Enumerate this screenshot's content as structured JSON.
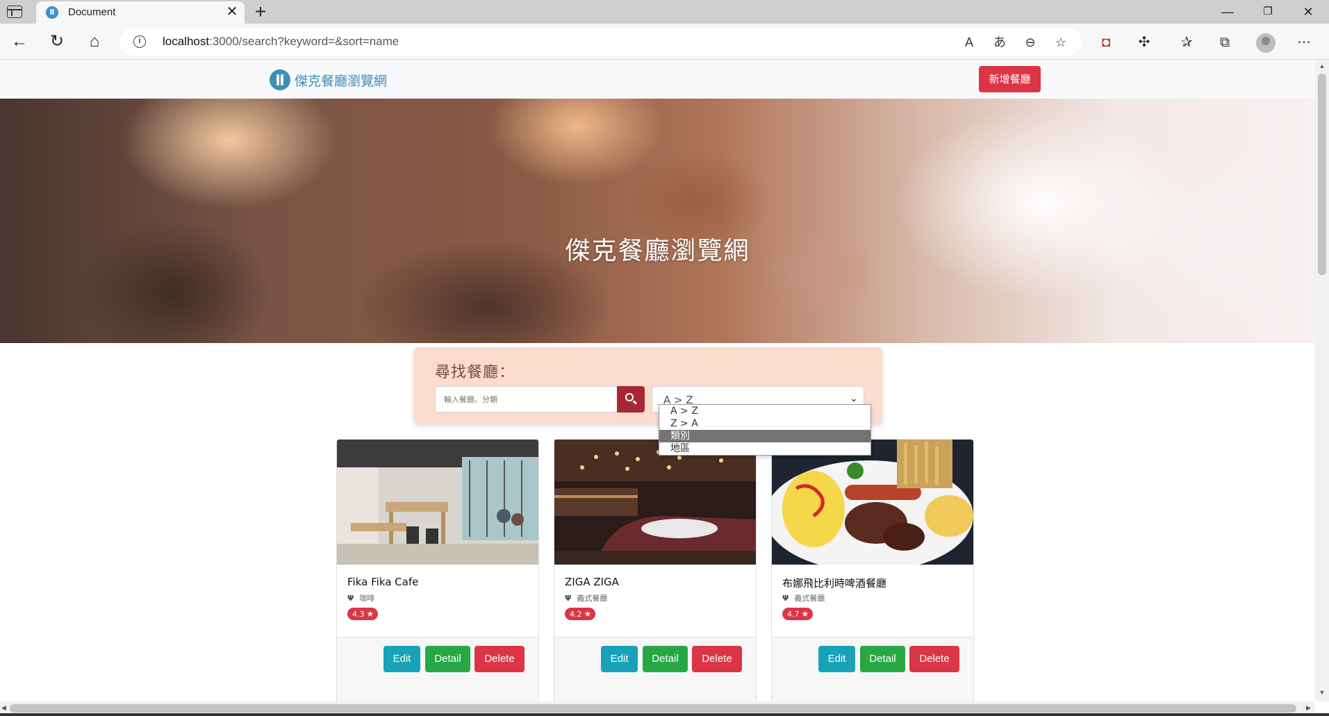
{
  "browser": {
    "tab_title": "Document",
    "tab_favicon": "Ⅱ",
    "close_glyph": "✕",
    "new_tab_glyph": "+",
    "url_host": "localhost",
    "url_rest": ":3000/search?keyword=&sort=name",
    "window_controls": [
      "—",
      "❐",
      "✕"
    ]
  },
  "nav": {
    "brand": "傑克餐廳瀏覽網",
    "add_button": "新增餐廳"
  },
  "banner": {
    "title": "傑克餐廳瀏覽網"
  },
  "search": {
    "label": "尋找餐廳：",
    "placeholder": "輸入餐廳、分類",
    "sort_value": "A > Z",
    "sort_options": [
      "A > Z",
      "Z > A",
      "類別",
      "地區"
    ],
    "highlighted_option": "類別"
  },
  "restaurants": [
    {
      "name": "Fika Fika Cafe",
      "category": "咖啡",
      "rating": "4.3"
    },
    {
      "name": "ZIGA ZIGA",
      "category": "義式餐廳",
      "rating": "4.2"
    },
    {
      "name": "布娜飛比利時啤酒餐廳",
      "category": "義式餐廳",
      "rating": "4.7"
    }
  ],
  "card_buttons": {
    "edit": "Edit",
    "detail": "Detail",
    "delete": "Delete"
  },
  "colors": {
    "brand": "#3c8fb8",
    "danger": "#dc3545",
    "info": "#17a2b8",
    "success": "#28a745",
    "search_panel": "#fbdccf"
  }
}
